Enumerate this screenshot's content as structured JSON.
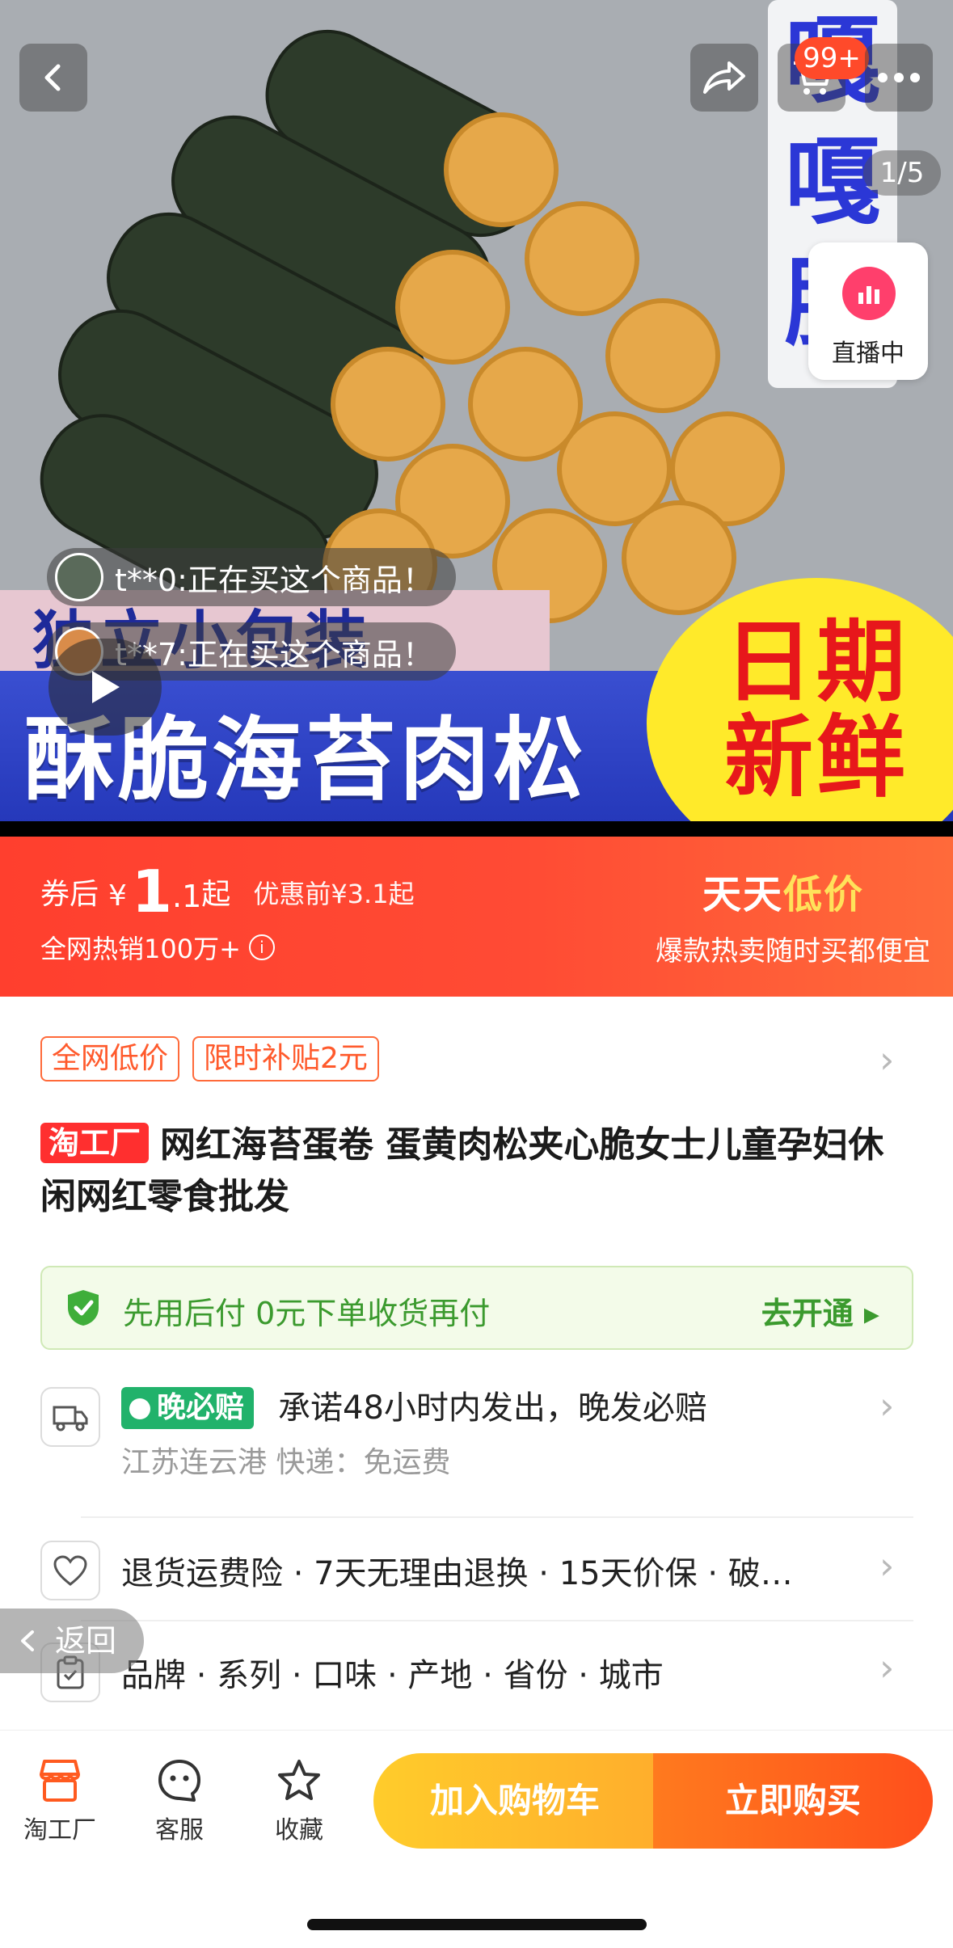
{
  "hero": {
    "side_word": [
      "嘎",
      "嘎",
      "脆"
    ],
    "caption_top": "独立小包装",
    "caption_main": "酥脆海苔肉松卷",
    "fresh_text": "日期新鲜",
    "cart_badge": "99+",
    "page_indicator": "1/5",
    "live_label": "直播中",
    "tickers": [
      {
        "text": "t**0:正在买这个商品！"
      },
      {
        "text": "t**7:正在买这个商品！"
      }
    ]
  },
  "price": {
    "label": "券后",
    "currency": "¥",
    "integer": "1",
    "decimal": ".1",
    "suffix": "起",
    "original": "优惠前¥3.1起",
    "sales": "全网热销100万+",
    "brand_a": "天天",
    "brand_b": "低价",
    "slogan": "爆款热卖随时买都便宜"
  },
  "tags": [
    "全网低价",
    "限时补贴2元"
  ],
  "product": {
    "shop_logo": "淘工厂",
    "title": "网红海苔蛋卷 蛋黄肉松夹心脆女士儿童孕妇休闲网红零食批发"
  },
  "paylater": {
    "text": "先用后付  0元下单收货再付",
    "action": "去开通 ▸"
  },
  "shipping": {
    "badge": "晚必赔",
    "promise": "承诺48小时内发出，晚发必赔",
    "origin": "江苏连云港  快递：免运费"
  },
  "guarantee": {
    "text": "退货运费险 · 7天无理由退换 · 15天价保 · 破…"
  },
  "params": {
    "text": "品牌 · 系列 · 口味 · 产地 · 省份 · 城市"
  },
  "back_float": "返回",
  "bottom": {
    "factory": "淘工厂",
    "service": "客服",
    "favorite": "收藏",
    "add_cart": "加入购物车",
    "buy_now": "立即购买"
  },
  "colors": {
    "accent": "#ff4b34",
    "brand_yellow": "#ffe25a",
    "green": "#3b9a2e"
  }
}
